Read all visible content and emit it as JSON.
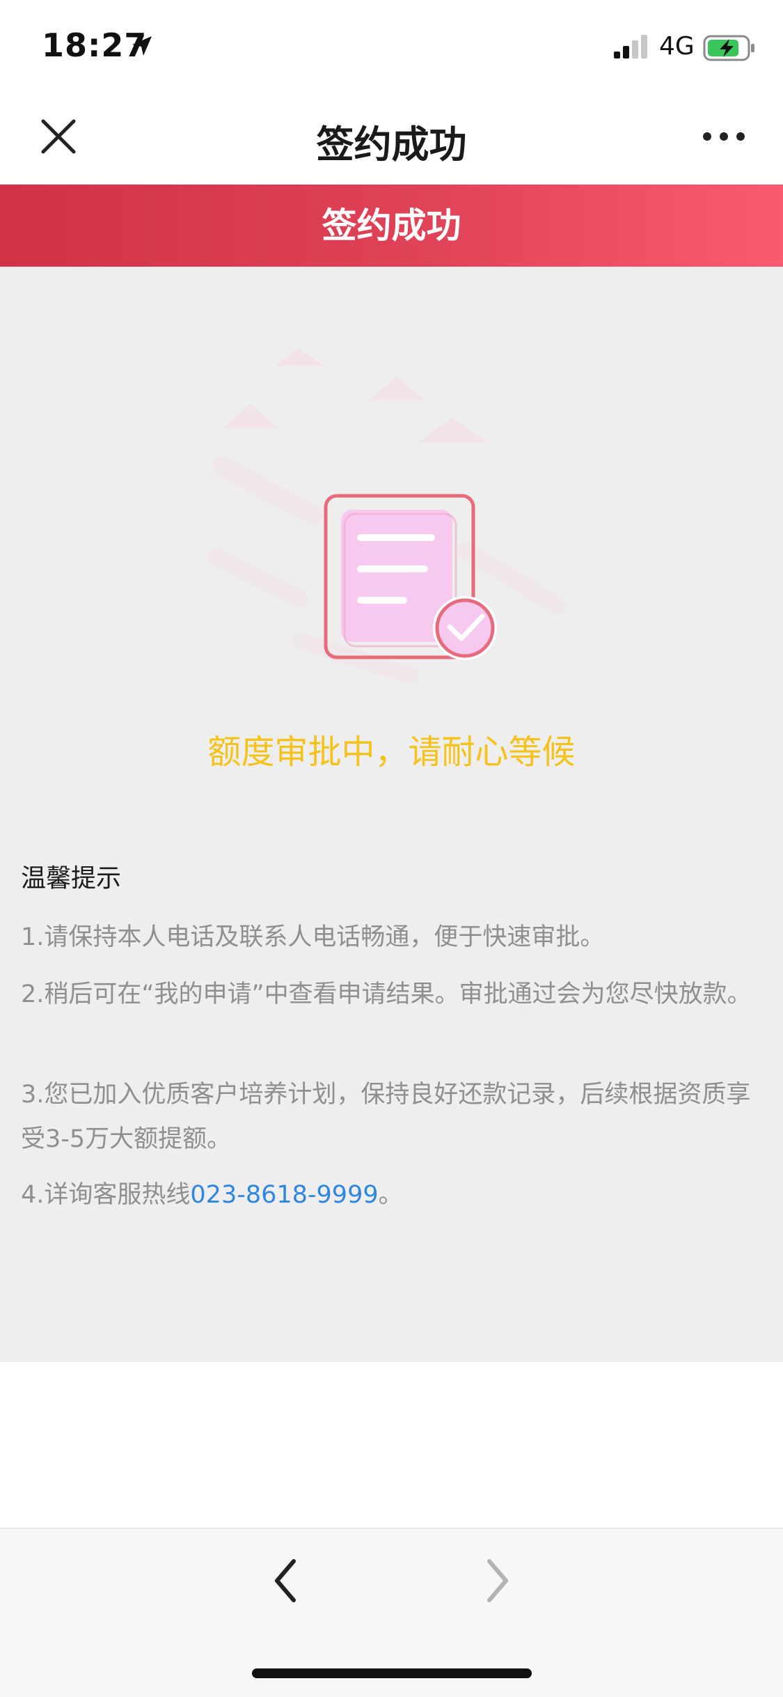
{
  "status_bar": {
    "time": "18:27",
    "network": "4G",
    "icons": [
      "location-arrow-icon",
      "signal-icon",
      "battery-charging-icon"
    ]
  },
  "nav": {
    "title": "签约成功",
    "close_icon": "close-icon",
    "more_icon": "more-icon"
  },
  "banner": {
    "text": "签约成功",
    "colors": {
      "start": "#d13246",
      "end": "#fb5b71"
    }
  },
  "illustration": {
    "icon": "document-check-icon"
  },
  "status_message": {
    "text": "额度审批中，请耐心等候",
    "color": "#f4c21a"
  },
  "tips": {
    "title": "温馨提示",
    "items": [
      "1.请保持本人电话及联系人电话畅通，便于快速审批。",
      "2.稍后可在“我的申请”中查看申请结果。审批通过会为您尽快放款。",
      "3.您已加入优质客户培养计划，保持良好还款记录，后续根据资质享受3-5万大额提额。"
    ],
    "hotline_prefix": "4.详询客服热线",
    "hotline_number": "023-8618-9999",
    "hotline_suffix": "。",
    "link_color": "#2f86e0"
  },
  "toolbar": {
    "back_icon": "chevron-left-icon",
    "forward_icon": "chevron-right-icon"
  }
}
